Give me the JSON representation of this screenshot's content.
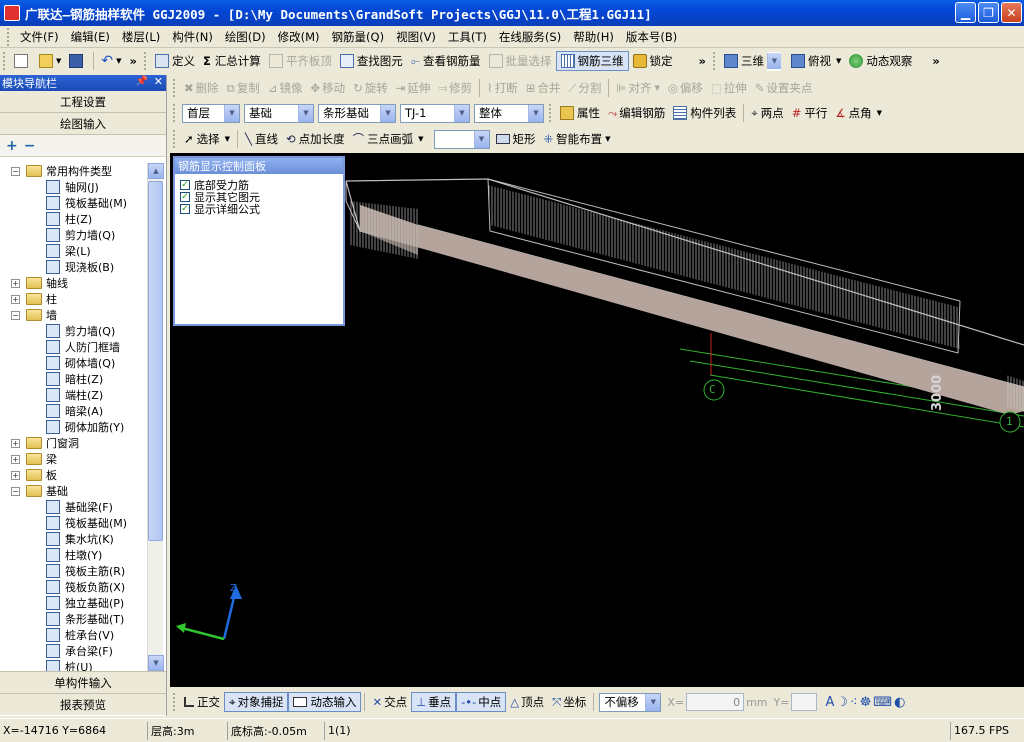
{
  "window": {
    "title": "广联达—钢筋抽样软件 GGJ2009 - [D:\\My Documents\\GrandSoft Projects\\GGJ\\11.0\\工程1.GGJ11]",
    "min_icon": "minimize-icon",
    "max_icon": "maximize-icon",
    "close_icon": "close-icon"
  },
  "menu": [
    "文件(F)",
    "编辑(E)",
    "楼层(L)",
    "构件(N)",
    "绘图(D)",
    "修改(M)",
    "钢筋量(Q)",
    "视图(V)",
    "工具(T)",
    "在线服务(S)",
    "帮助(H)",
    "版本号(B)"
  ],
  "toolbar1": {
    "define": "定义",
    "sum": "汇总计算",
    "flush": "平齐板顶",
    "find": "查找图元",
    "view_rebar": "查看钢筋量",
    "batch": "批量选择",
    "rebar3d": "钢筋三维",
    "lock": "锁定",
    "view3d": "三维",
    "top_view": "俯视",
    "dynamic": "动态观察"
  },
  "toolbar2": [
    "删除",
    "复制",
    "镜像",
    "移动",
    "旋转",
    "延伸",
    "修剪",
    "打断",
    "合并",
    "分割",
    "对齐",
    "偏移",
    "拉伸",
    "设置夹点"
  ],
  "toolbar3": {
    "floor": "首层",
    "category": "基础",
    "type": "条形基础",
    "member": "TJ-1",
    "scope": "整体",
    "property": "属性",
    "edit_rebar": "编辑钢筋",
    "member_list": "构件列表",
    "two_points": "两点",
    "parallel": "平行",
    "point_angle": "点角"
  },
  "toolbar4": {
    "select": "选择",
    "line": "直线",
    "point_length": "点加长度",
    "arc": "三点画弧",
    "rect": "矩形",
    "smart": "智能布置"
  },
  "nav": {
    "title": "模块导航栏",
    "project": "工程设置",
    "draw": "绘图输入",
    "tree": [
      {
        "kind": "folder",
        "open": true,
        "label": "常用构件类型"
      },
      {
        "kind": "leaf",
        "label": "轴网(J)"
      },
      {
        "kind": "leaf",
        "label": "筏板基础(M)"
      },
      {
        "kind": "leaf",
        "label": "柱(Z)"
      },
      {
        "kind": "leaf",
        "label": "剪力墙(Q)"
      },
      {
        "kind": "leaf",
        "label": "梁(L)"
      },
      {
        "kind": "leaf",
        "label": "现浇板(B)"
      },
      {
        "kind": "folder",
        "open": false,
        "label": "轴线"
      },
      {
        "kind": "folder",
        "open": false,
        "label": "柱"
      },
      {
        "kind": "folder",
        "open": true,
        "label": "墙"
      },
      {
        "kind": "leaf",
        "label": "剪力墙(Q)"
      },
      {
        "kind": "leaf",
        "label": "人防门框墙"
      },
      {
        "kind": "leaf",
        "label": "砌体墙(Q)"
      },
      {
        "kind": "leaf",
        "label": "暗柱(Z)"
      },
      {
        "kind": "leaf",
        "label": "端柱(Z)"
      },
      {
        "kind": "leaf",
        "label": "暗梁(A)"
      },
      {
        "kind": "leaf",
        "label": "砌体加筋(Y)"
      },
      {
        "kind": "folder",
        "open": false,
        "label": "门窗洞"
      },
      {
        "kind": "folder",
        "open": false,
        "label": "梁"
      },
      {
        "kind": "folder",
        "open": false,
        "label": "板"
      },
      {
        "kind": "folder",
        "open": true,
        "label": "基础"
      },
      {
        "kind": "leaf",
        "label": "基础梁(F)"
      },
      {
        "kind": "leaf",
        "label": "筏板基础(M)"
      },
      {
        "kind": "leaf",
        "label": "集水坑(K)"
      },
      {
        "kind": "leaf",
        "label": "柱墩(Y)"
      },
      {
        "kind": "leaf",
        "label": "筏板主筋(R)"
      },
      {
        "kind": "leaf",
        "label": "筏板负筋(X)"
      },
      {
        "kind": "leaf",
        "label": "独立基础(P)"
      },
      {
        "kind": "leaf",
        "label": "条形基础(T)"
      },
      {
        "kind": "leaf",
        "label": "桩承台(V)"
      },
      {
        "kind": "leaf",
        "label": "承台梁(F)"
      },
      {
        "kind": "leaf",
        "label": "桩(U)"
      }
    ],
    "single_input": "单构件输入",
    "report": "报表预览"
  },
  "panel": {
    "title": "钢筋显示控制面板",
    "items": [
      "底部受力筋",
      "显示其它图元",
      "显示详细公式"
    ]
  },
  "canvas": {
    "axis_c": "C",
    "axis_1": "1",
    "dimension": "3000",
    "z_label": "Z"
  },
  "bottom": {
    "ortho": "正交",
    "snap": "对象捕捉",
    "dyn_input": "动态输入",
    "intersect": "交点",
    "perp": "垂点",
    "mid": "中点",
    "vertex": "顶点",
    "coord": "坐标",
    "offset": "不偏移",
    "x_label": "X=",
    "x_val": "0",
    "unit": "mm",
    "y_label": "Y="
  },
  "status": {
    "coords": "X=-14716 Y=6864",
    "floor_height": "层高:3m",
    "base_elev": "底标高:-0.05m",
    "count": "1(1)",
    "fps": "167.5 FPS"
  },
  "colors": {
    "title_blue": "#0347d6",
    "canvas_bg": "#000000",
    "beam_fill": "#b5a49b",
    "grid_green": "#2fb22f",
    "axis_blue": "#1f6be0"
  }
}
